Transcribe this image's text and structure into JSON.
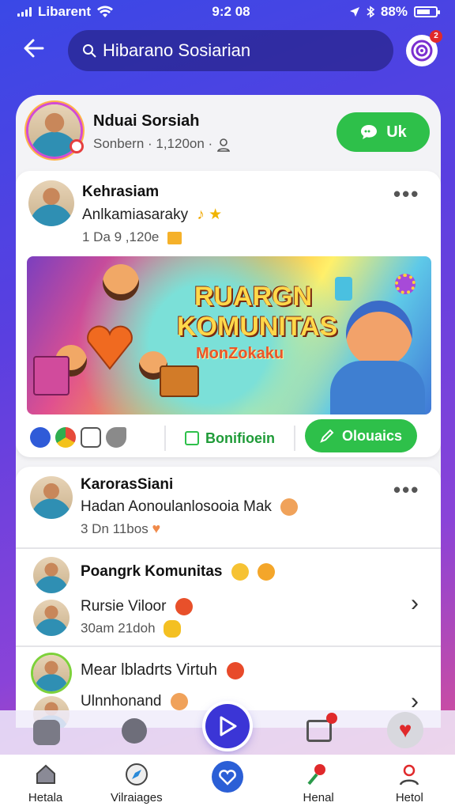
{
  "status_bar": {
    "carrier": "Libarent",
    "time": "9:2 08",
    "battery": "88%"
  },
  "top_bar": {
    "search_value": "Hibarano Sosiarian",
    "notification_count": "2"
  },
  "profile": {
    "name": "Nduai Sorsiah",
    "meta": "Sonbern · 1,120on ·",
    "follow_label": "Uk"
  },
  "post1": {
    "author": "Kehrasiam",
    "text": "Anlkamiasaraky",
    "meta": "1 Da 9 ,120e",
    "banner_title_line1": "RUARGN",
    "banner_title_line2": "KOMUNITAS",
    "banner_sub": "MonZokaku",
    "btn_outline": "Bonifioein",
    "btn_green": "Olouaics"
  },
  "post2": {
    "author": "KarorasSiani",
    "text": "Hadan Aonoulanlosooia Mak",
    "meta": "3 Dn 11bos"
  },
  "list": [
    {
      "title": "Poangrk Komunitas",
      "subtitle": "Rursie Viloor",
      "meta": "30am 21doh"
    },
    {
      "title": "Mear lbladrts Virtuh",
      "subtitle": "Ulnnhonand"
    }
  ],
  "bottom_nav": [
    {
      "label": "Hetala"
    },
    {
      "label": "Vilraiages"
    },
    {
      "label": ""
    },
    {
      "label": "Henal"
    },
    {
      "label": "Hetol"
    }
  ],
  "colors": {
    "accent_green": "#2ec04a",
    "brand_purple": "#5a3fe0",
    "fab_blue": "#3b35d6"
  }
}
